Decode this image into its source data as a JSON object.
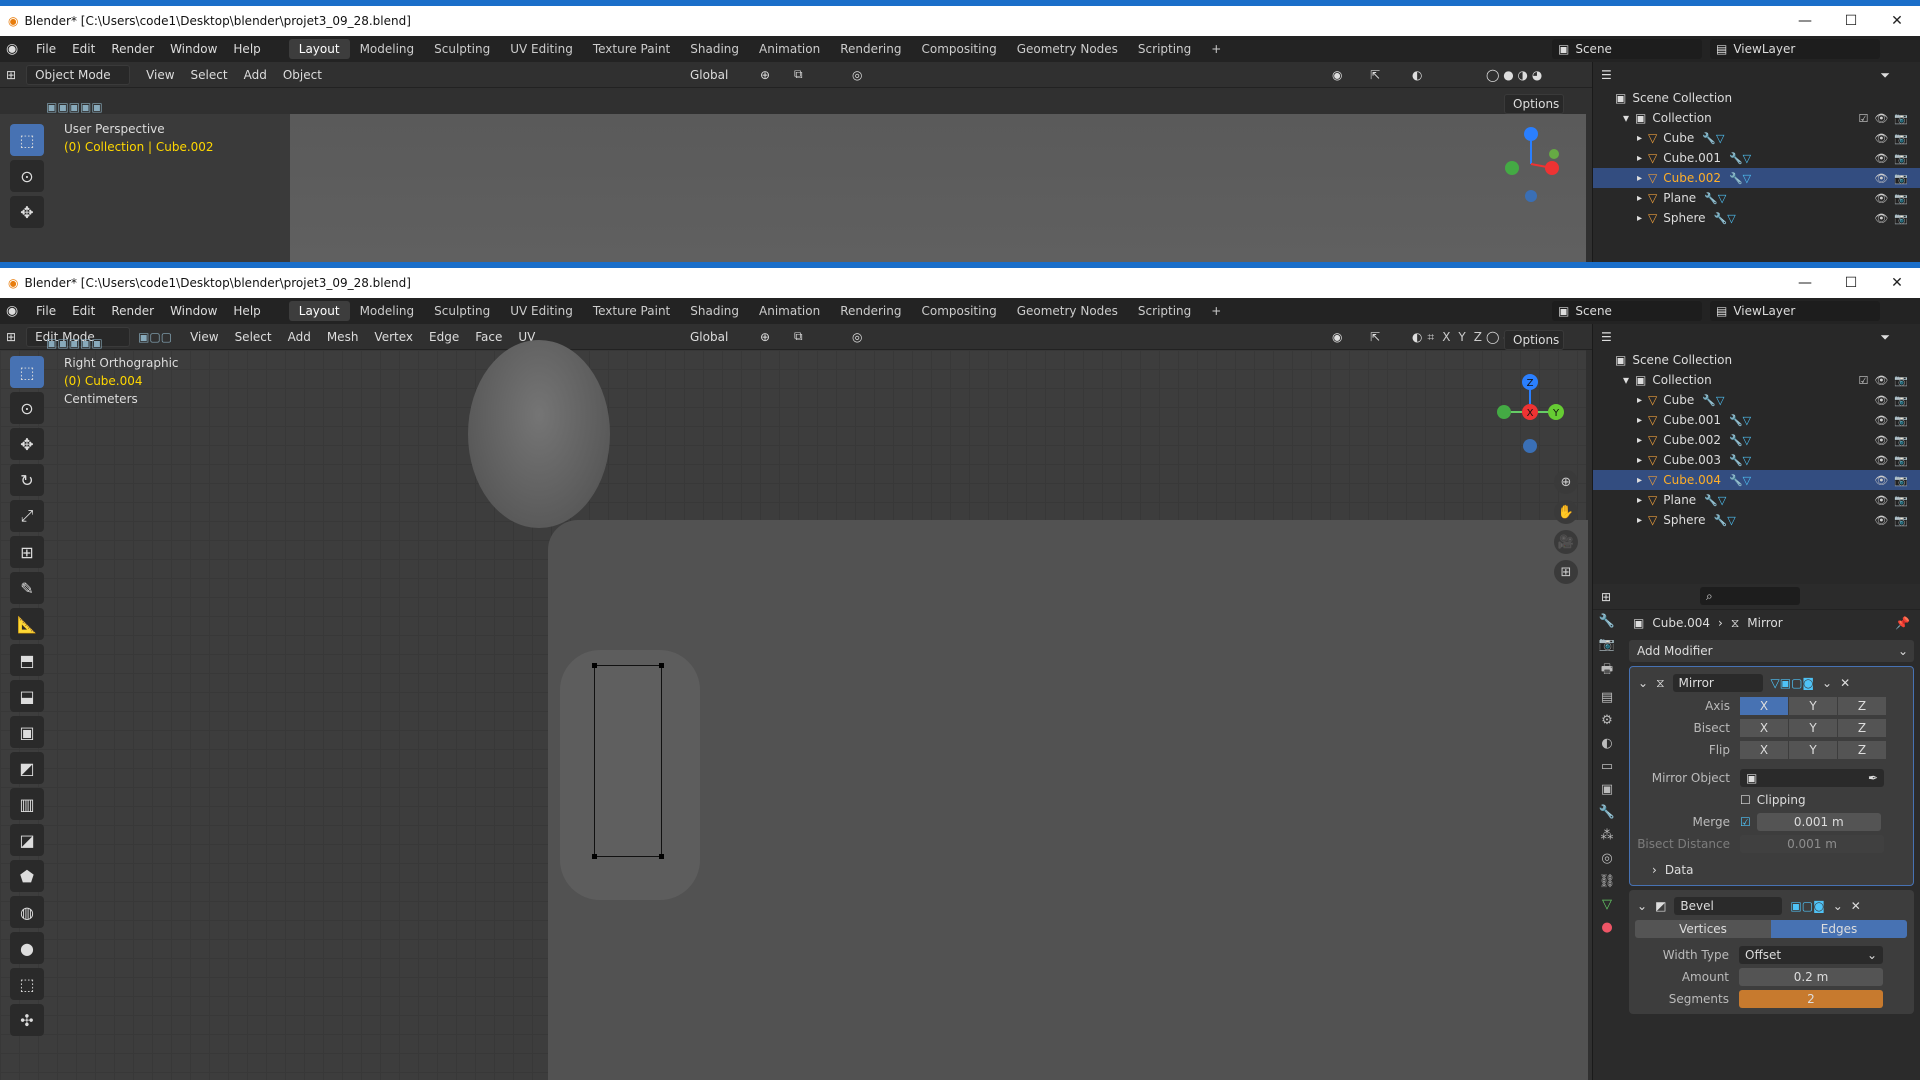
{
  "window1": {
    "title": "Blender* [C:\\Users\\code1\\Desktop\\blender\\projet3_09_28.blend]",
    "menu": [
      "File",
      "Edit",
      "Render",
      "Window",
      "Help"
    ],
    "workspaces": [
      "Layout",
      "Modeling",
      "Sculpting",
      "UV Editing",
      "Texture Paint",
      "Shading",
      "Animation",
      "Rendering",
      "Compositing",
      "Geometry Nodes",
      "Scripting",
      "+"
    ],
    "scene": "Scene",
    "view_layer": "ViewLayer",
    "mode": "Object Mode",
    "header_menu": [
      "View",
      "Select",
      "Add",
      "Object"
    ],
    "transform": "Global",
    "options": "Options",
    "view_name": "User Perspective",
    "view_context": "(0) Collection | Cube.002",
    "outliner": {
      "root": "Scene Collection",
      "collection": "Collection",
      "items": [
        {
          "name": "Cube",
          "selected": false
        },
        {
          "name": "Cube.001",
          "selected": false
        },
        {
          "name": "Cube.002",
          "selected": true
        },
        {
          "name": "Plane",
          "selected": false
        },
        {
          "name": "Sphere",
          "selected": false
        }
      ]
    }
  },
  "window2": {
    "title": "Blender* [C:\\Users\\code1\\Desktop\\blender\\projet3_09_28.blend]",
    "mode": "Edit Mode",
    "header_menu": [
      "View",
      "Select",
      "Add",
      "Mesh",
      "Vertex",
      "Edge",
      "Face",
      "UV"
    ],
    "transform": "Global",
    "options": "Options",
    "axis_lock": [
      "X",
      "Y",
      "Z"
    ],
    "view_name": "Right Orthographic",
    "view_context": "(0) Cube.004",
    "units": "Centimeters",
    "gizmo_axes": {
      "z": "Z",
      "x": "X",
      "y": "Y"
    },
    "outliner": {
      "root": "Scene Collection",
      "collection": "Collection",
      "items": [
        {
          "name": "Cube",
          "selected": false
        },
        {
          "name": "Cube.001",
          "selected": false
        },
        {
          "name": "Cube.002",
          "selected": false
        },
        {
          "name": "Cube.003",
          "selected": false
        },
        {
          "name": "Cube.004",
          "selected": true
        },
        {
          "name": "Plane",
          "selected": false
        },
        {
          "name": "Sphere",
          "selected": false
        }
      ]
    },
    "properties": {
      "breadcrumb_object": "Cube.004",
      "breadcrumb_modifier": "Mirror",
      "add_modifier": "Add Modifier",
      "mirror": {
        "name": "Mirror",
        "axis_label": "Axis",
        "bisect_label": "Bisect",
        "flip_label": "Flip",
        "xyz": [
          "X",
          "Y",
          "Z"
        ],
        "mirror_object_label": "Mirror Object",
        "clipping_label": "Clipping",
        "merge_label": "Merge",
        "merge_value": "0.001 m",
        "bisect_distance_label": "Bisect Distance",
        "bisect_distance_value": "0.001 m",
        "data_label": "Data"
      },
      "bevel": {
        "name": "Bevel",
        "vertices": "Vertices",
        "edges": "Edges",
        "width_type_label": "Width Type",
        "width_type_value": "Offset",
        "amount_label": "Amount",
        "amount_value": "0.2 m",
        "segments_label": "Segments",
        "segments_value": "2"
      }
    }
  },
  "colors": {
    "accent": "#4772b3",
    "selected_text": "#ffaf29",
    "info_yellow": "#ffd700",
    "segments": "#c77a2e"
  }
}
